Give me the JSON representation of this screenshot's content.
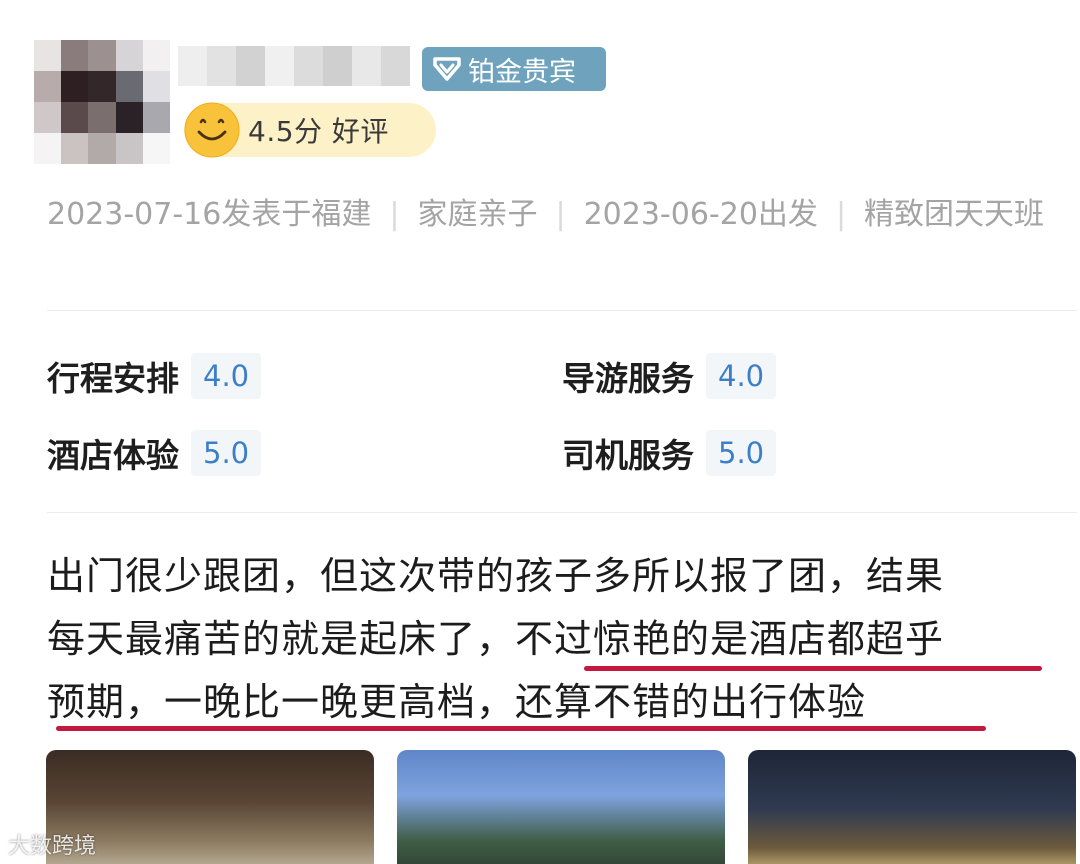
{
  "header": {
    "vip_badge": "铂金贵宾",
    "rating": "4.5分 好评"
  },
  "meta": {
    "posted": "2023-07-16发表于福建",
    "trip_type": "家庭亲子",
    "departure": "2023-06-20出发",
    "product": "精致团天天班"
  },
  "scores": [
    {
      "label": "行程安排",
      "value": "4.0"
    },
    {
      "label": "导游服务",
      "value": "4.0"
    },
    {
      "label": "酒店体验",
      "value": "5.0"
    },
    {
      "label": "司机服务",
      "value": "5.0"
    }
  ],
  "review": {
    "line1": "出门很少跟团，但这次带的孩子多所以报了团，结果",
    "line2": "每天最痛苦的就是起床了，不过惊艳的是酒店都超乎",
    "line3": "预期，一晚比一晚更高档，还算不错的出行体验"
  },
  "watermark": "大数跨境",
  "colors": {
    "vip_badge": "#6fa3bd",
    "rating_pill": "#fdf1c8",
    "score_value": "#3c7fc8",
    "underline": "#c4183f"
  }
}
